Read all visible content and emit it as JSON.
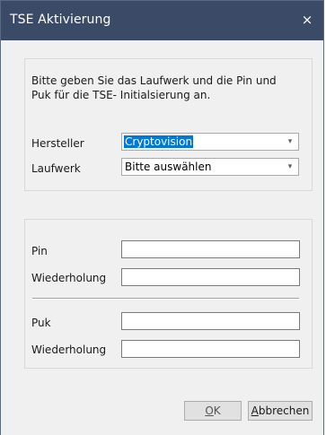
{
  "window": {
    "title": "TSE Aktivierung",
    "close_glyph": "×"
  },
  "group_device": {
    "intro_text": "Bitte geben Sie das Laufwerk und die Pin und Puk für die TSE- Initialsierung an.",
    "manufacturer_label": "Hersteller",
    "manufacturer_value": "Cryptovision",
    "drive_label": "Laufwerk",
    "drive_value": "Bitte auswählen",
    "dropdown_glyph": "▾"
  },
  "group_credentials": {
    "pin_label": "Pin",
    "pin_value": "",
    "pin_repeat_label": "Wiederholung",
    "pin_repeat_value": "",
    "puk_label": "Puk",
    "puk_value": "",
    "puk_repeat_label": "Wiederholung",
    "puk_repeat_value": ""
  },
  "buttons": {
    "ok_mnemonic": "O",
    "ok_rest": "K",
    "cancel_mnemonic": "A",
    "cancel_rest": "bbrechen"
  },
  "colors": {
    "titlebar": "#3b4a66",
    "selection": "#0078d7",
    "dialog_bg": "#f0f0f0"
  }
}
